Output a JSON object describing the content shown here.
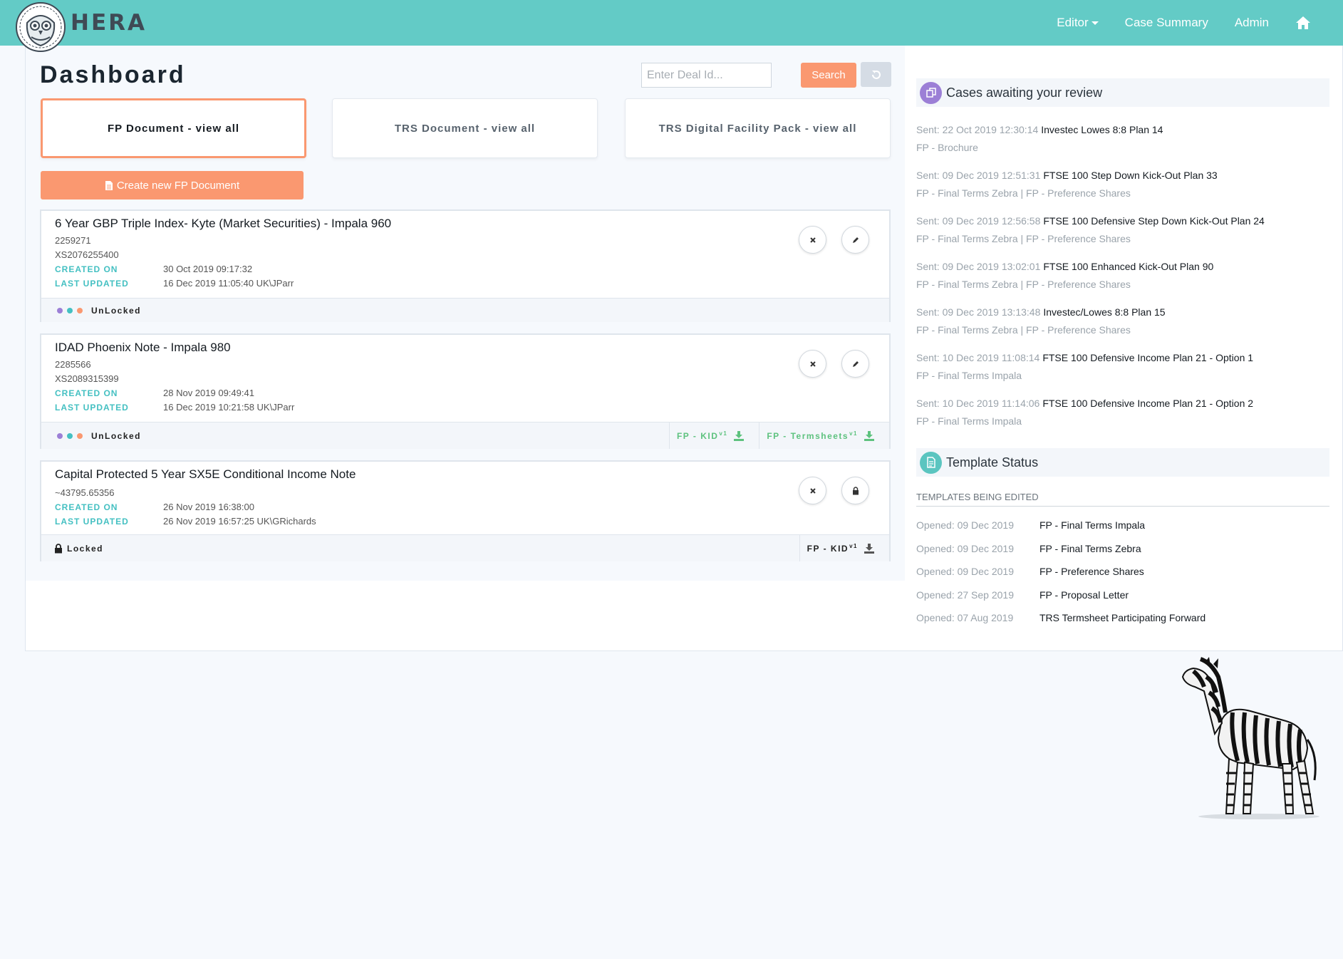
{
  "nav": {
    "brand": "HERA",
    "links": [
      {
        "label": "Editor"
      },
      {
        "label": "Case Summary"
      },
      {
        "label": "Admin"
      }
    ]
  },
  "dashboard": {
    "title": "Dashboard",
    "search": {
      "placeholder": "Enter Deal Id...",
      "button": "Search"
    },
    "tabs": [
      "FP Document - view all",
      "TRS Document - view all",
      "TRS Digital Facility Pack - view all"
    ],
    "create_button": "Create new FP Document"
  },
  "labels": {
    "created_on": "CREATED ON",
    "last_updated": "LAST UPDATED"
  },
  "cards": [
    {
      "title": "6 Year GBP Triple Index- Kyte (Market Securities) - Impala 960",
      "id": "2259271",
      "isin": "XS2076255400",
      "created_on": "30 Oct 2019 09:17:32",
      "last_updated": "16 Dec 2019 11:05:40 UK\\JParr",
      "status": "UnLocked",
      "downloads": []
    },
    {
      "title": "IDAD Phoenix Note - Impala 980",
      "id": "2285566",
      "isin": "XS2089315399",
      "created_on": "28 Nov 2019 09:49:41",
      "last_updated": "16 Dec 2019 10:21:58 UK\\JParr",
      "status": "UnLocked",
      "downloads": [
        {
          "label": "FP - KID",
          "version": "v1"
        },
        {
          "label": "FP - Termsheets",
          "version": "v1"
        }
      ]
    },
    {
      "title": "Capital Protected 5 Year SX5E Conditional Income Note",
      "id": "~43795.65356",
      "created_on": "26 Nov 2019 16:38:00",
      "last_updated": "26 Nov 2019 16:57:25 UK\\GRichards",
      "status": "Locked",
      "downloads": [
        {
          "label": "FP - KID",
          "version": "v1"
        }
      ]
    }
  ],
  "review": {
    "title": "Cases awaiting your review",
    "items": [
      {
        "sent": "Sent: 22 Oct 2019 12:30:14",
        "name": "Investec Lowes 8:8 Plan 14",
        "type": "FP - Brochure"
      },
      {
        "sent": "Sent: 09 Dec 2019 12:51:31",
        "name": "FTSE 100 Step Down Kick-Out Plan 33",
        "type": "FP - Final Terms Zebra | FP - Preference Shares"
      },
      {
        "sent": "Sent: 09 Dec 2019 12:56:58",
        "name": "FTSE 100 Defensive Step Down Kick-Out Plan 24",
        "type": "FP - Final Terms Zebra | FP - Preference Shares"
      },
      {
        "sent": "Sent: 09 Dec 2019 13:02:01",
        "name": "FTSE 100 Enhanced Kick-Out Plan 90",
        "type": "FP - Final Terms Zebra | FP - Preference Shares"
      },
      {
        "sent": "Sent: 09 Dec 2019 13:13:48",
        "name": "Investec/Lowes 8:8 Plan 15",
        "type": "FP - Final Terms Zebra | FP - Preference Shares"
      },
      {
        "sent": "Sent: 10 Dec 2019 11:08:14",
        "name": "FTSE 100 Defensive Income Plan 21 - Option 1",
        "type": "FP - Final Terms Impala"
      },
      {
        "sent": "Sent: 10 Dec 2019 11:14:06",
        "name": "FTSE 100 Defensive Income Plan 21 - Option 2",
        "type": "FP - Final Terms Impala"
      }
    ]
  },
  "template_status": {
    "title": "Template Status",
    "subtitle": "TEMPLATES BEING EDITED",
    "items": [
      {
        "opened": "Opened: 09 Dec 2019",
        "name": "FP - Final Terms Impala"
      },
      {
        "opened": "Opened: 09 Dec 2019",
        "name": "FP - Final Terms Zebra"
      },
      {
        "opened": "Opened: 09 Dec 2019",
        "name": "FP - Preference Shares"
      },
      {
        "opened": "Opened: 27 Sep 2019",
        "name": "FP - Proposal Letter"
      },
      {
        "opened": "Opened: 07 Aug 2019",
        "name": "TRS Termsheet Participating Forward"
      }
    ]
  },
  "colors": {
    "navbar": "#63cbc6",
    "accent_orange": "#fa9870",
    "label_teal": "#44c0c2",
    "download_green": "#5dc27e",
    "dot_purple": "#9c7fd6",
    "dot_teal": "#44c0c2",
    "dot_orange": "#fa9870",
    "review_icon": "#9c7fd6",
    "template_icon": "#5bc5c0"
  },
  "icons": {
    "home": "home-icon",
    "refresh": "refresh-icon",
    "file": "file-icon",
    "close": "close-icon",
    "edit": "pencil-icon",
    "lock": "lock-icon",
    "download": "download-icon",
    "cases": "copy-icon",
    "template": "document-icon"
  }
}
